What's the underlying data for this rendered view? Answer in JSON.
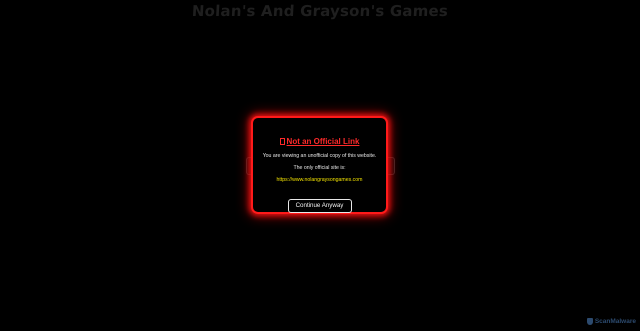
{
  "site": {
    "title": "Nolan's And Grayson's Games"
  },
  "modal": {
    "title": "Not an Official Link",
    "line1": "You are viewing an unofficial copy of this website.",
    "line2": "The only official site is:",
    "official_url": "https://www.nolangraysongames.com",
    "continue_label": "Continue Anyway",
    "warning_icon": "warning-icon"
  },
  "badge": {
    "label": "ScanMalware",
    "icon": "shield-icon"
  },
  "colors": {
    "background": "#000000",
    "accent_red": "#ff1a1a",
    "link_yellow": "#f0e000",
    "badge_blue": "#2c4a6e"
  }
}
